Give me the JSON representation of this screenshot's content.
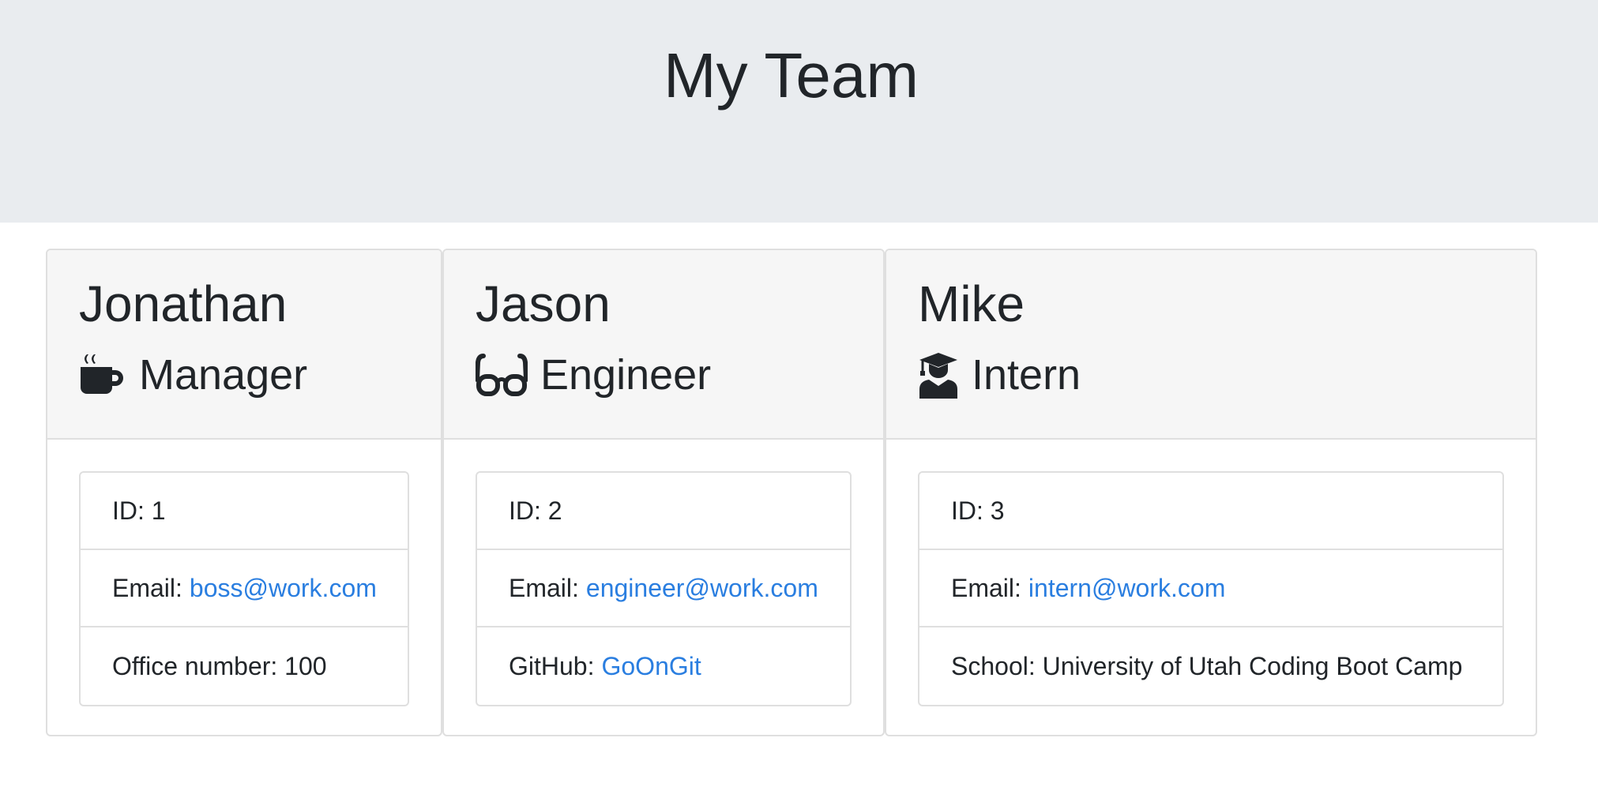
{
  "header": {
    "title": "My Team"
  },
  "colors": {
    "header_bg": "#e9ecef",
    "card_header_bg": "#f6f6f6",
    "link": "#2a7ee0",
    "text": "#212529"
  },
  "cards": [
    {
      "name": "Jonathan",
      "role": "Manager",
      "role_icon": "coffee-mug-icon",
      "id_label": "ID: 1",
      "email_label": "Email:",
      "email": "boss@work.com",
      "extra_label": "Office number: 100",
      "extra_value": ""
    },
    {
      "name": "Jason",
      "role": "Engineer",
      "role_icon": "glasses-icon",
      "id_label": "ID: 2",
      "email_label": "Email:",
      "email": "engineer@work.com",
      "extra_label": "GitHub:",
      "extra_value": "GoOnGit"
    },
    {
      "name": "Mike",
      "role": "Intern",
      "role_icon": "graduate-icon",
      "id_label": "ID: 3",
      "email_label": "Email:",
      "email": "intern@work.com",
      "extra_label": "School: University of Utah Coding Boot Camp",
      "extra_value": ""
    }
  ]
}
